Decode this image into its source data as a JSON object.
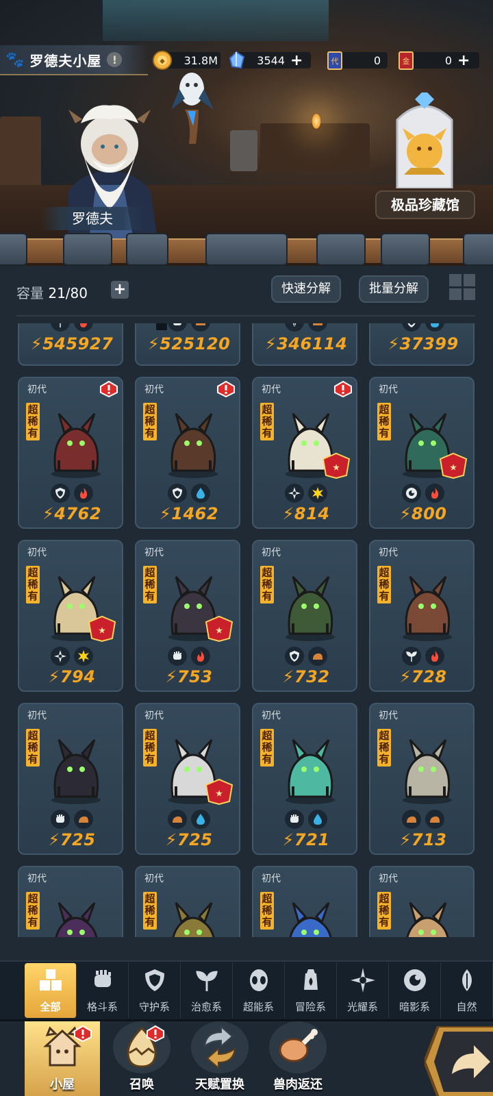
{
  "header": {
    "house_title": "罗德夫小屋",
    "info_icon": "exclamation-icon",
    "resources": [
      {
        "icon": "coin-icon",
        "value": "31.8M",
        "has_plus": false
      },
      {
        "icon": "crystal-icon",
        "value": "3544",
        "has_plus": true
      },
      {
        "icon": "blue-ticket-icon",
        "value": "0",
        "has_plus": false
      },
      {
        "icon": "gold-ticket-icon",
        "value": "0",
        "has_plus": true
      }
    ]
  },
  "scene": {
    "npc_name": "罗德夫",
    "museum_button": "极品珍藏馆"
  },
  "inventory": {
    "capacity_label": "容量",
    "capacity_value": "21/80",
    "quick_decompose": "快速分解",
    "batch_decompose": "批量分解",
    "generation_label": "初代",
    "rarity_label": "超稀有",
    "top_row": [
      {
        "types": [
          "heal",
          "fire"
        ],
        "power": "545927",
        "locked": false
      },
      {
        "types": [
          "fight",
          "adventure"
        ],
        "power": "525120",
        "locked": true
      },
      {
        "types": [
          "nature",
          "adventure"
        ],
        "power": "346114",
        "locked": false
      },
      {
        "types": [
          "guard",
          "water"
        ],
        "power": "37399",
        "locked": false
      }
    ],
    "cards": [
      {
        "types": [
          "guard",
          "fire"
        ],
        "power": "4762",
        "alert": true,
        "badge": false,
        "color": "#7a2d2d"
      },
      {
        "types": [
          "guard",
          "water"
        ],
        "power": "1462",
        "alert": true,
        "badge": false,
        "color": "#5a3a2a"
      },
      {
        "types": [
          "light",
          "star"
        ],
        "power": "814",
        "alert": true,
        "badge": true,
        "color": "#e8e2d0"
      },
      {
        "types": [
          "dark",
          "fire"
        ],
        "power": "800",
        "alert": false,
        "badge": true,
        "color": "#2f6a5a"
      },
      {
        "types": [
          "light",
          "star"
        ],
        "power": "794",
        "alert": false,
        "badge": true,
        "color": "#d9c79a"
      },
      {
        "types": [
          "fight",
          "fire"
        ],
        "power": "753",
        "alert": false,
        "badge": true,
        "color": "#3a3540"
      },
      {
        "types": [
          "guard",
          "adventure"
        ],
        "power": "732",
        "alert": false,
        "badge": false,
        "color": "#3e5a36"
      },
      {
        "types": [
          "heal",
          "fire"
        ],
        "power": "728",
        "alert": false,
        "badge": false,
        "color": "#7a4a36"
      },
      {
        "types": [
          "fight",
          "adventure"
        ],
        "power": "725",
        "alert": false,
        "badge": false,
        "color": "#2c2a34"
      },
      {
        "types": [
          "adventure",
          "water"
        ],
        "power": "725",
        "alert": false,
        "badge": true,
        "color": "#d8d8d8"
      },
      {
        "types": [
          "fight",
          "water"
        ],
        "power": "721",
        "alert": false,
        "badge": false,
        "color": "#4fb8a0"
      },
      {
        "types": [
          "adventure",
          "adventure"
        ],
        "power": "713",
        "alert": false,
        "badge": false,
        "color": "#b9b5a4"
      },
      {
        "types": [],
        "power": "",
        "alert": false,
        "badge": false,
        "color": "#4b2f5a"
      },
      {
        "types": [],
        "power": "",
        "alert": false,
        "badge": false,
        "color": "#8a7a3a"
      },
      {
        "types": [],
        "power": "",
        "alert": false,
        "badge": false,
        "color": "#3a6ac8"
      },
      {
        "types": [],
        "power": "",
        "alert": false,
        "badge": false,
        "color": "#c8a070"
      }
    ]
  },
  "categories": [
    {
      "label": "全部",
      "icon": "all-icon",
      "active": true
    },
    {
      "label": "格斗系",
      "icon": "fist-icon",
      "active": false
    },
    {
      "label": "守护系",
      "icon": "shield-icon",
      "active": false
    },
    {
      "label": "治愈系",
      "icon": "sprout-icon",
      "active": false
    },
    {
      "label": "超能系",
      "icon": "psychic-icon",
      "active": false
    },
    {
      "label": "冒险系",
      "icon": "lantern-icon",
      "active": false
    },
    {
      "label": "光耀系",
      "icon": "light-icon",
      "active": false
    },
    {
      "label": "暗影系",
      "icon": "shadow-icon",
      "active": false
    },
    {
      "label": "自然",
      "icon": "leaf-icon",
      "active": false
    }
  ],
  "nav": [
    {
      "label": "小屋",
      "icon": "house-icon",
      "alert": true,
      "active": true
    },
    {
      "label": "召唤",
      "icon": "egg-icon",
      "alert": true,
      "active": false
    },
    {
      "label": "天赋置换",
      "icon": "swap-icon",
      "alert": false,
      "active": false
    },
    {
      "label": "兽肉返还",
      "icon": "meat-icon",
      "alert": false,
      "active": false
    }
  ],
  "colors": {
    "power": "#f5a623",
    "rarity_bg": "#f4b32a",
    "alert": "#e02b2b",
    "accent_gold": "#ffd56a"
  }
}
